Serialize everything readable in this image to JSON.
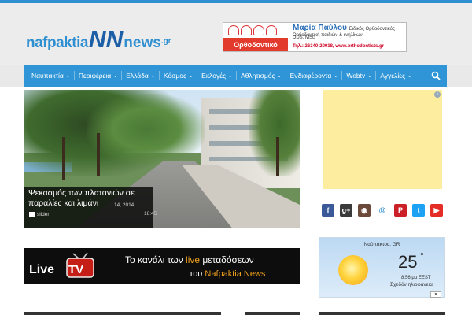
{
  "site": {
    "logo_part1": "nafpaktia",
    "logo_mark": "NN",
    "logo_part2": "news",
    "logo_tld": ".gr"
  },
  "header_ad": {
    "name": "Μαρία Παύλου",
    "subtitle": "Ειδικός Ορθοδοντικός DDS, MSc",
    "line2": "Ορθοδοντική παιδιών & ενηλίκων",
    "red_label": "Ορθοδοντικό Ιατρείο",
    "phone": "Τηλ.: 26340-20018, www.orthodontists.gr"
  },
  "nav": {
    "items": [
      {
        "label": "Ναυπακτία"
      },
      {
        "label": "Περιφέρεια"
      },
      {
        "label": "Ελλάδα"
      },
      {
        "label": "Κόσμος"
      },
      {
        "label": "Εκλογές"
      },
      {
        "label": "Αθλητισμός"
      },
      {
        "label": "Ενδιαφέροντα"
      },
      {
        "label": "Webtv"
      },
      {
        "label": "Αγγελίες"
      }
    ],
    "chevron": "⌄"
  },
  "slider": {
    "title": "Ψεκασμός των πλατανιών σε παραλίες και λιμάνι",
    "category": "slider",
    "date": "14, 2014",
    "time": "18:45"
  },
  "social": [
    {
      "icon": "facebook-icon",
      "glyph": "f",
      "color": "#3b5998"
    },
    {
      "icon": "googleplus-icon",
      "glyph": "g+",
      "color": "#3a3a3a"
    },
    {
      "icon": "instagram-icon",
      "glyph": "◉",
      "color": "#6b4a3a"
    },
    {
      "icon": "email-icon",
      "glyph": "@",
      "color": "#ffffff"
    },
    {
      "icon": "pinterest-icon",
      "glyph": "P",
      "color": "#cb2027"
    },
    {
      "icon": "twitter-icon",
      "glyph": "t",
      "color": "#1da1f2"
    },
    {
      "icon": "youtube-icon",
      "glyph": "▶",
      "color": "#e52d27"
    }
  ],
  "livetv": {
    "logo_text": "Live TV",
    "line1_a": "Το κανάλι των",
    "line1_hl": "live",
    "line1_b": "μεταδόσεων",
    "line2_a": "του",
    "line2_hl": "Nafpaktia News"
  },
  "weather": {
    "city": "Ναύπακτος, GR",
    "temp": "25",
    "deg": "°",
    "time": "8:56 μμ EEST",
    "condition": "Σχεδόν ηλιοφάνεια",
    "badge": "✕"
  },
  "ad_info": "i"
}
